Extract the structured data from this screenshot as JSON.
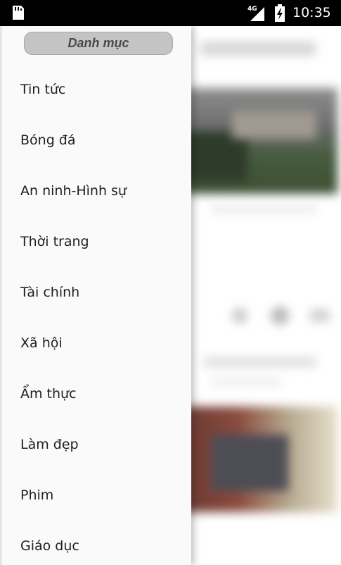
{
  "status_bar": {
    "network_type": "4G",
    "time": "10:35",
    "icons": [
      "sd-card-icon",
      "signal-icon",
      "battery-charging-icon"
    ]
  },
  "drawer": {
    "header_title": "Danh mục",
    "items": [
      {
        "label": "Tin tức"
      },
      {
        "label": "Bóng đá"
      },
      {
        "label": "An ninh-Hình sự"
      },
      {
        "label": "Thời trang"
      },
      {
        "label": "Tài chính"
      },
      {
        "label": "Xã hội"
      },
      {
        "label": "Ẩm thực"
      },
      {
        "label": "Làm đẹp"
      },
      {
        "label": "Phim"
      },
      {
        "label": "Giáo dục"
      }
    ]
  },
  "colors": {
    "status_bar_bg": "#000000",
    "drawer_bg": "#fafafa",
    "header_pill_bg": "#c4c4c4",
    "header_text": "#4a4a4a",
    "menu_text": "#1e1e1e"
  }
}
